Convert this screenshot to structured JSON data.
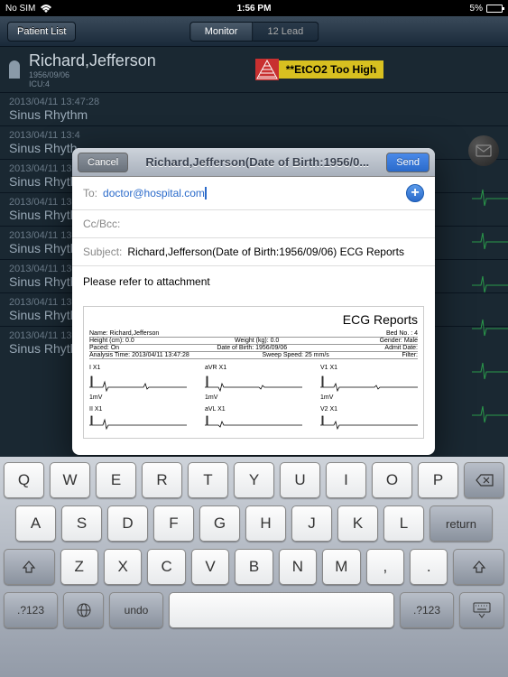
{
  "statusbar": {
    "carrier": "No SIM",
    "time": "1:56 PM",
    "battery": "5%"
  },
  "navbar": {
    "back_label": "Patient List",
    "seg_monitor": "Monitor",
    "seg_12lead": "12 Lead"
  },
  "patient": {
    "name": "Richard,Jefferson",
    "dob": "1956/09/06",
    "location": "ICU:4"
  },
  "alert": {
    "text": "**EtCO2 Too High"
  },
  "history": {
    "items": [
      {
        "time": "2013/04/11 13:47:28",
        "label": "Sinus Rhythm"
      },
      {
        "time": "2013/04/11 13:4",
        "label": "Sinus Rhyth"
      },
      {
        "time": "2013/04/11 13:4",
        "label": "Sinus Rhyth"
      },
      {
        "time": "2013/04/11 13:4",
        "label": "Sinus Rhyth"
      },
      {
        "time": "2013/04/11 13:4",
        "label": "Sinus Rhyth"
      },
      {
        "time": "2013/04/11 13:4",
        "label": "Sinus Rhyth"
      },
      {
        "time": "2013/04/11 13:4",
        "label": "Sinus Rhyth"
      },
      {
        "time": "2013/04/11 13:4",
        "label": "Sinus Rhyth"
      }
    ]
  },
  "modal": {
    "cancel": "Cancel",
    "send": "Send",
    "title": "Richard,Jefferson(Date of Birth:1956/0...",
    "to_label": "To:",
    "to_value": "doctor@hospital.com",
    "cc_label": "Cc/Bcc:",
    "subject_label": "Subject:",
    "subject_value": "Richard,Jefferson(Date of Birth:1956/09/06) ECG Reports",
    "body": "Please refer to attachment",
    "attachment": {
      "title": "ECG Reports",
      "name_label": "Name: Richard,Jefferson",
      "bed_label": "Bed No. : 4",
      "height_label": "Height (cm): 0.0",
      "weight_label": "Weight (kg): 0.0",
      "gender_label": "Gender: Male",
      "paced_label": "Paced: On",
      "dob_label": "Date of Birth: 1956/09/06",
      "admit_label": "Admit Date:",
      "analysis_label": "Analysis Time: 2013/04/11 13:47:28",
      "sweep_label": "Sweep Speed: 25 mm/s",
      "filter_label": "Filter:",
      "leads_row1": [
        "I X1",
        "aVR X1",
        "V1 X1"
      ],
      "leads_row2": [
        "II X1",
        "aVL X1",
        "V2 X1"
      ],
      "mv": "1mV"
    }
  },
  "keyboard": {
    "row1": [
      "Q",
      "W",
      "E",
      "R",
      "T",
      "Y",
      "U",
      "I",
      "O",
      "P"
    ],
    "row2": [
      "A",
      "S",
      "D",
      "F",
      "G",
      "H",
      "J",
      "K",
      "L"
    ],
    "row3": [
      "Z",
      "X",
      "C",
      "V",
      "B",
      "N",
      "M",
      ",",
      "."
    ],
    "undo": "undo",
    "return": "return",
    "numkey": ".?123"
  }
}
